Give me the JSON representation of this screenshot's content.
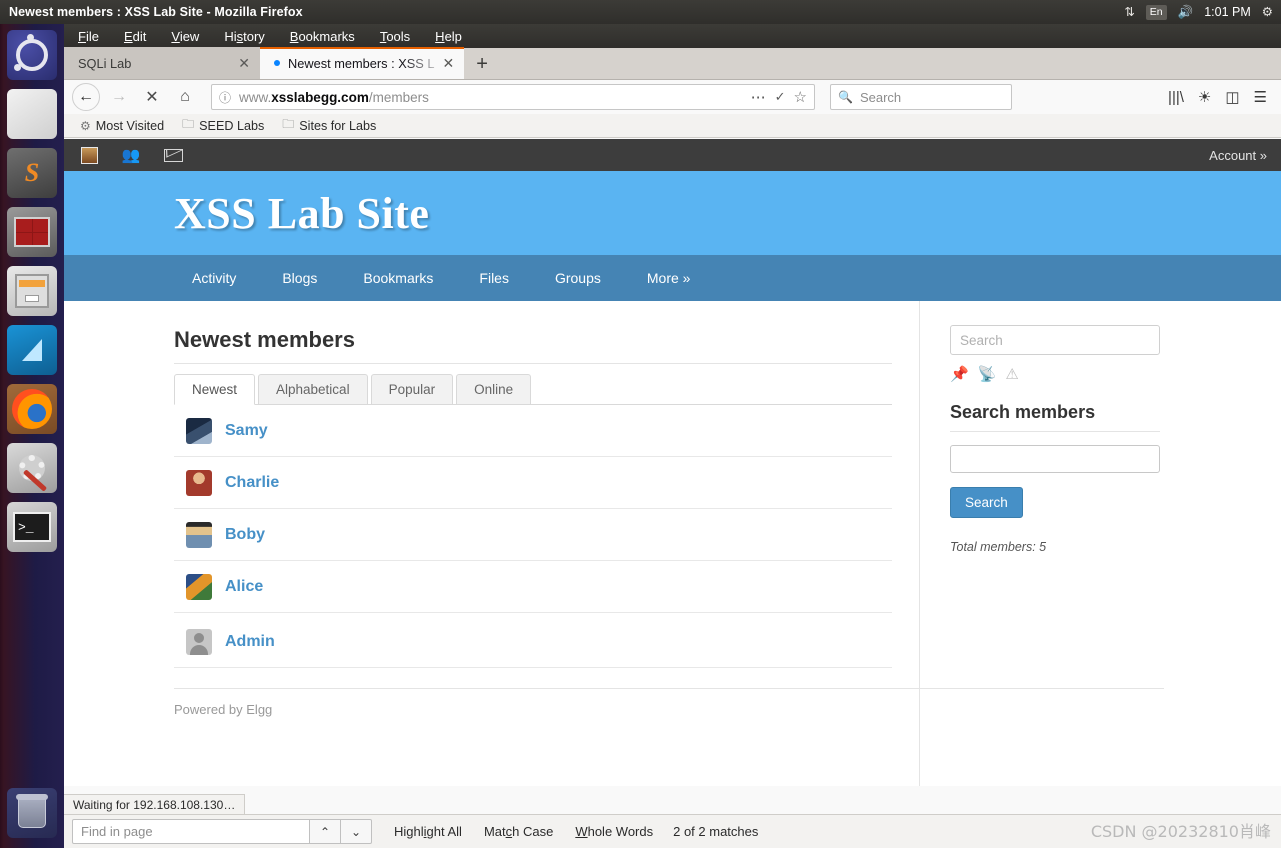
{
  "os": {
    "window_title": "Newest members : XSS Lab Site - Mozilla Firefox",
    "tray": {
      "network_icon": "network-up-down-icon",
      "language": "En",
      "volume_icon": "volume-icon",
      "clock": "1:01 PM",
      "settings_icon": "gear-icon"
    },
    "launcher": [
      {
        "name": "ubuntu-dash",
        "label": "Ubuntu Dash"
      },
      {
        "name": "text-editor",
        "label": "Text Editor"
      },
      {
        "name": "sublime-text",
        "label": "Sublime Text"
      },
      {
        "name": "terminator",
        "label": "Terminator"
      },
      {
        "name": "file-manager",
        "label": "Files"
      },
      {
        "name": "wireshark",
        "label": "Wireshark"
      },
      {
        "name": "firefox",
        "label": "Firefox"
      },
      {
        "name": "system-settings",
        "label": "System Settings"
      },
      {
        "name": "terminal",
        "label": "Terminal"
      },
      {
        "name": "trash",
        "label": "Trash"
      }
    ]
  },
  "browser": {
    "menu": [
      "File",
      "Edit",
      "View",
      "History",
      "Bookmarks",
      "Tools",
      "Help"
    ],
    "tabs": [
      {
        "title": "SQLi Lab",
        "active": false
      },
      {
        "title": "Newest members : XSS L",
        "active": true
      }
    ],
    "new_tab_label": "+",
    "url": {
      "host": "www.xsslabegg.com",
      "path": "/members",
      "prefix": "www.",
      "bold": "xsslabegg.com"
    },
    "url_full": "www.xsslabegg.com/members",
    "search_placeholder": "Search",
    "bookmarks": [
      {
        "label": "Most Visited",
        "icon": "star-gear-icon"
      },
      {
        "label": "SEED Labs",
        "icon": "folder-icon"
      },
      {
        "label": "Sites for Labs",
        "icon": "folder-icon"
      }
    ],
    "toolbar_icons": [
      "library-icon",
      "sync-account-icon",
      "sidebar-icon",
      "hamburger-menu-icon"
    ],
    "status_text": "Waiting for 192.168.108.130…",
    "findbar": {
      "placeholder": "Find in page",
      "prev_label": "⌃",
      "next_label": "⌄",
      "highlight_all": "Highlight All",
      "match_case": "Match Case",
      "whole_words": "Whole Words",
      "match_count": "2 of 2 matches"
    }
  },
  "site": {
    "topbar": {
      "icons": [
        "user-avatar-icon",
        "friends-icon",
        "mail-icon"
      ],
      "account_label": "Account  »"
    },
    "title": "XSS Lab Site",
    "nav": [
      "Activity",
      "Blogs",
      "Bookmarks",
      "Files",
      "Groups",
      "More  »"
    ],
    "page_title": "Newest members",
    "tabs": [
      {
        "label": "Newest",
        "selected": true
      },
      {
        "label": "Alphabetical",
        "selected": false
      },
      {
        "label": "Popular",
        "selected": false
      },
      {
        "label": "Online",
        "selected": false
      }
    ],
    "members": [
      {
        "name": "Samy",
        "avatar": "av-samy",
        "highlighted": false
      },
      {
        "name": "Charlie",
        "avatar": "av-charlie",
        "highlighted": false
      },
      {
        "name": "Boby",
        "avatar": "av-boby",
        "highlighted": false
      },
      {
        "name": "Alice",
        "avatar": "av-alice",
        "highlighted": true
      },
      {
        "name": "Admin",
        "avatar": "av-admin",
        "highlighted": false
      }
    ],
    "footer": "Powered by Elgg",
    "sidebar": {
      "search_placeholder": "Search",
      "icons": [
        "pin-icon",
        "rss-icon",
        "warning-icon"
      ],
      "heading": "Search members",
      "input_value": "",
      "button_label": "Search",
      "total": "Total members: 5"
    }
  },
  "colors": {
    "header_blue": "#5ab4f2",
    "nav_blue": "#4584b4",
    "link_blue": "#4690c7",
    "highlight_red": "#e21b1b",
    "topbar_dark": "#3d3d3d",
    "firefox_orange": "#e66000"
  },
  "watermark": "CSDN @20232810肖峰"
}
